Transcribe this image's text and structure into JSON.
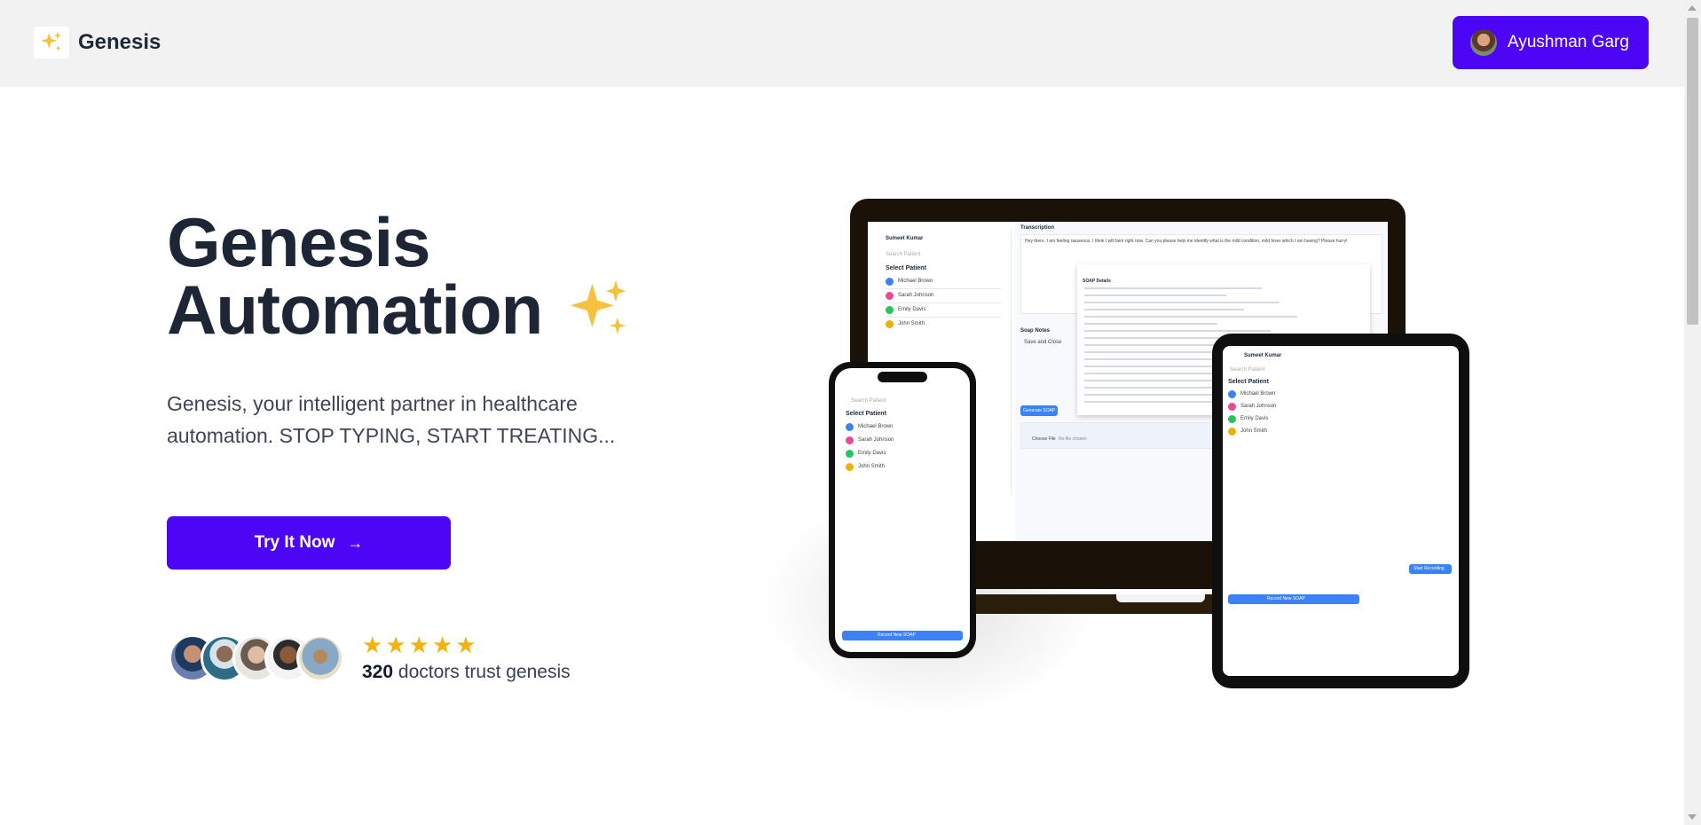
{
  "header": {
    "brand": "Genesis",
    "user_name": "Ayushman Garg"
  },
  "hero": {
    "title_line1": "Genesis",
    "title_line2": "Automation",
    "subtitle_line1": "Genesis, your intelligent partner in healthcare",
    "subtitle_line2": "automation. STOP TYPING, START TREATING...",
    "cta_label": "Try It Now",
    "cta_arrow": "→"
  },
  "trust": {
    "stars": [
      "★",
      "★",
      "★",
      "★",
      "★"
    ],
    "count": "320",
    "text": "doctors trust genesis"
  },
  "mockup": {
    "doctor_name": "Sumeet Kumar",
    "search_placeholder": "Search Patient",
    "select_patient": "Select Patient",
    "patients": [
      "Michael Brown",
      "Sarah Johnson",
      "Emily Davis",
      "John Smith"
    ],
    "transcription_label": "Transcription",
    "transcription_text": "Hey there, I am feeling nauseous. I think I will faint right now. Can you please help me identify what is the mild condition, mild fever which I am having? Please hurry!",
    "soap_notes_label": "Soap Notes",
    "save_close": "Save and Close",
    "generate_soap": "Generate SOAP",
    "choose_file": "Choose File",
    "no_file": "No file chosen",
    "record_new_soap": "Record New SOAP",
    "start_recording": "Start Recording",
    "soap_details": "SOAP Details"
  },
  "colors": {
    "primary": "#4c05f5",
    "star": "#f5b20c",
    "header_bg": "#f2f2f2"
  }
}
